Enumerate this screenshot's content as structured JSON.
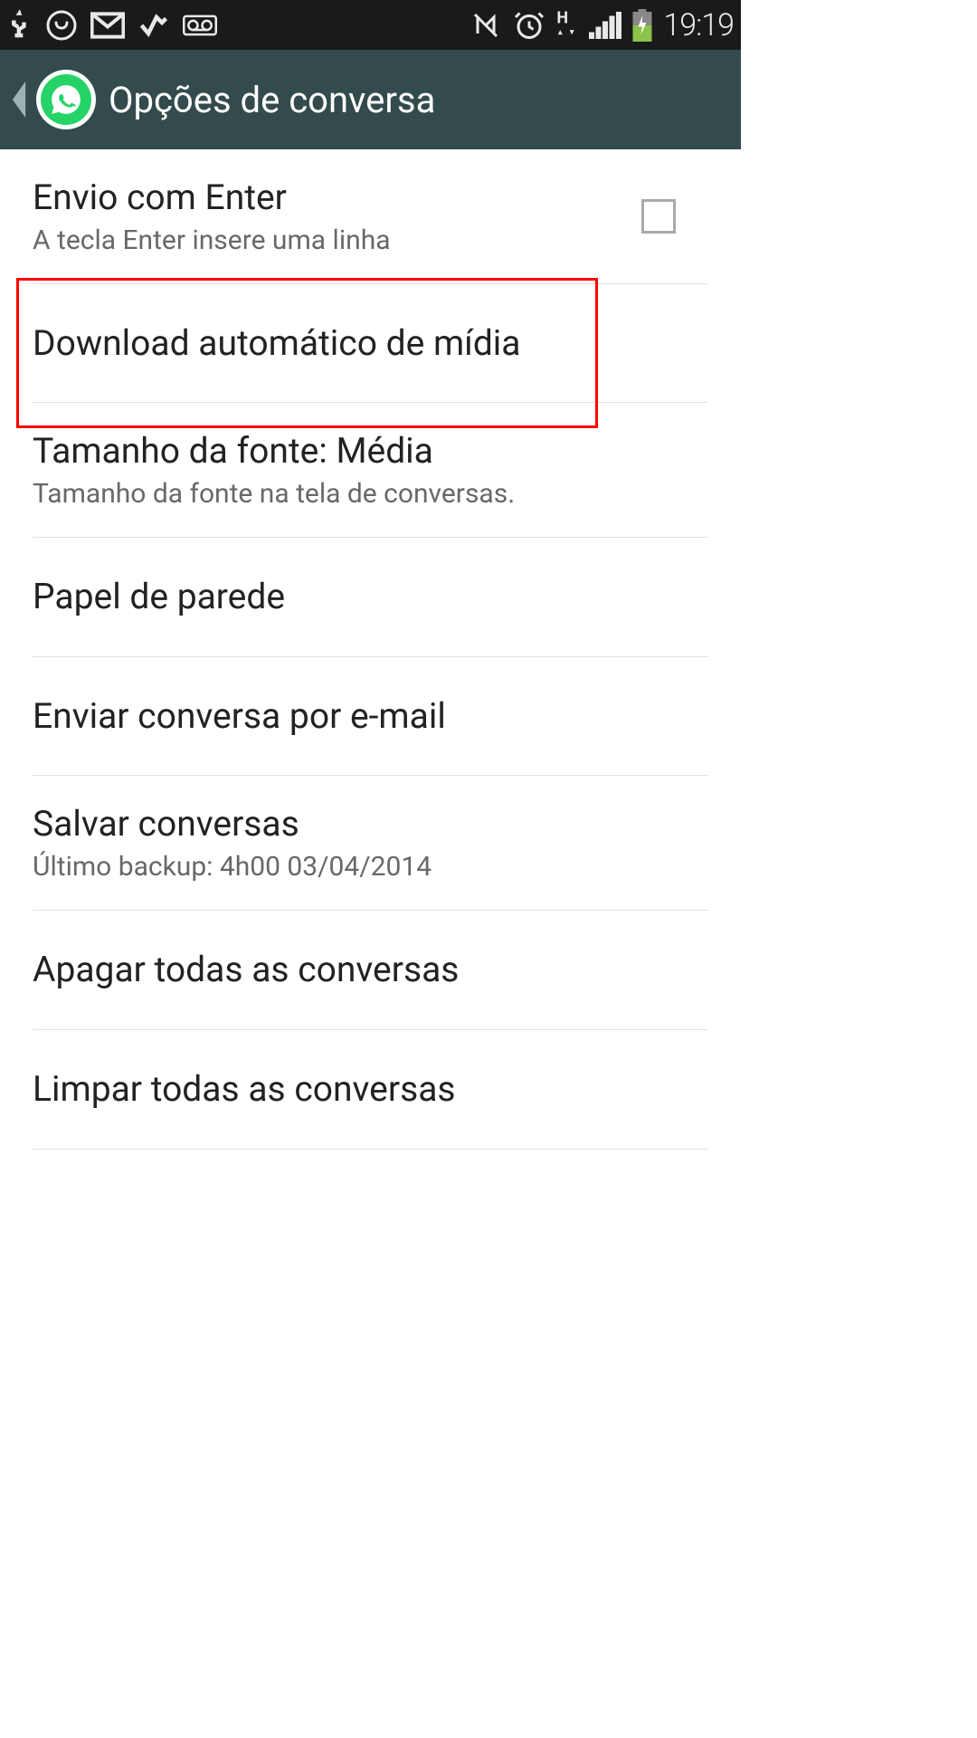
{
  "status": {
    "time": "19:19"
  },
  "header": {
    "title": "Opções de conversa"
  },
  "settings": {
    "enter_send": {
      "title": "Envio com Enter",
      "subtitle": "A tecla Enter insere uma linha"
    },
    "media_download": {
      "title": "Download automático de mídia"
    },
    "font_size": {
      "title": "Tamanho da fonte: Média",
      "subtitle": "Tamanho da fonte na tela de conversas."
    },
    "wallpaper": {
      "title": "Papel de parede"
    },
    "email_chat": {
      "title": "Enviar conversa por e-mail"
    },
    "backup": {
      "title": "Salvar conversas",
      "subtitle": "Último backup: 4h00 03/04/2014"
    },
    "delete_all": {
      "title": "Apagar todas as conversas"
    },
    "clear_all": {
      "title": "Limpar todas as conversas"
    }
  }
}
